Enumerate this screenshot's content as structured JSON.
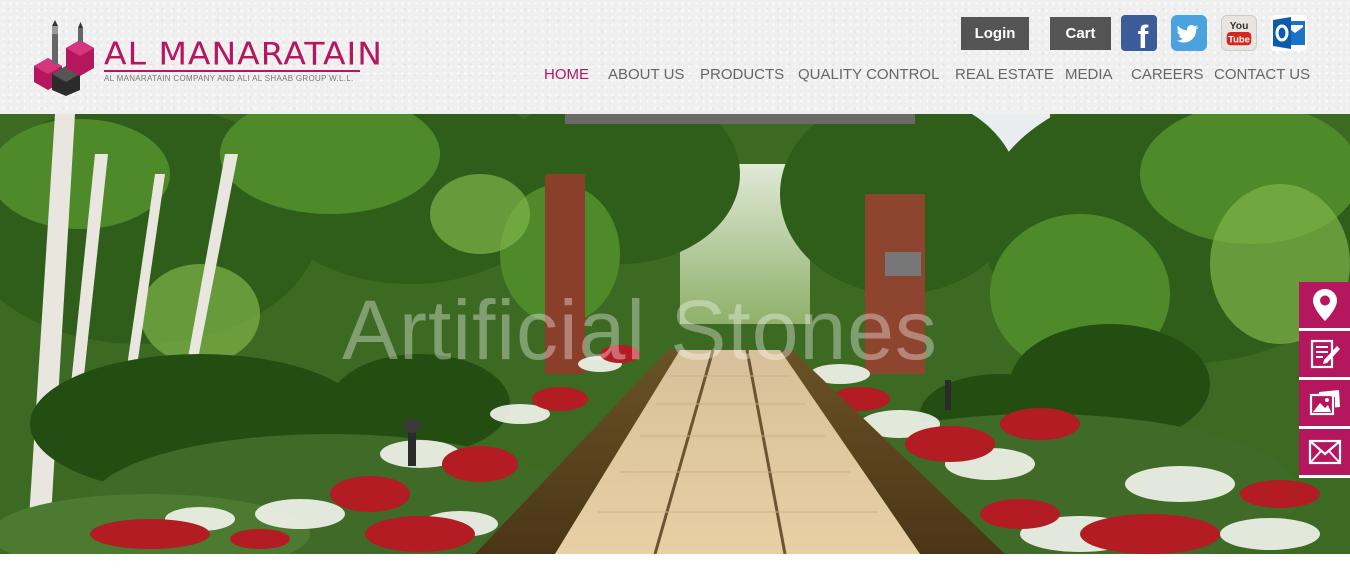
{
  "brand": {
    "name": "AL MANARATAIN",
    "subtitle": "AL MANARATAIN COMPANY AND ALI AL SHAAB GROUP W.L.L.",
    "accent_color": "#b5175e"
  },
  "header": {
    "login_label": "Login",
    "cart_label": "Cart",
    "social": [
      {
        "name": "facebook-icon",
        "glyph": "f"
      },
      {
        "name": "twitter-icon",
        "glyph": ""
      },
      {
        "name": "youtube-icon",
        "glyph_top": "You",
        "glyph_bottom": "Tube"
      },
      {
        "name": "outlook-icon",
        "glyph": "o"
      }
    ]
  },
  "nav": {
    "items": [
      {
        "label": "HOME",
        "active": true
      },
      {
        "label": "ABOUT US",
        "active": false
      },
      {
        "label": "PRODUCTS",
        "active": false
      },
      {
        "label": "QUALITY CONTROL",
        "active": false
      },
      {
        "label": "REAL ESTATE",
        "active": false
      },
      {
        "label": "MEDIA",
        "active": false
      },
      {
        "label": "CAREERS",
        "active": false
      },
      {
        "label": "CONTACT US",
        "active": false
      }
    ]
  },
  "hero": {
    "tagline": "Artificial Stones"
  },
  "side_tools": [
    {
      "name": "location-pin-icon"
    },
    {
      "name": "form-edit-icon"
    },
    {
      "name": "gallery-icon"
    },
    {
      "name": "mail-icon"
    }
  ]
}
